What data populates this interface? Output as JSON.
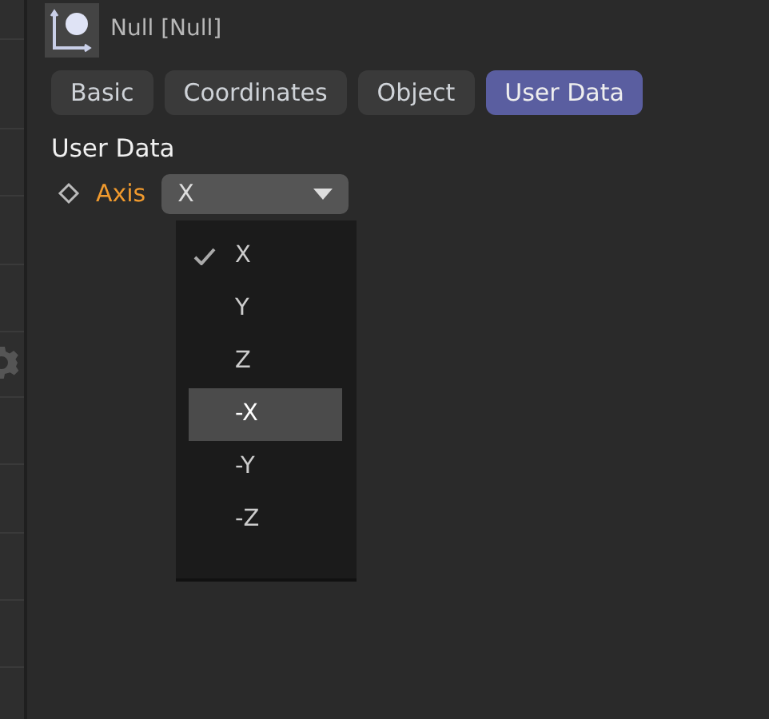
{
  "header": {
    "title": "Null [Null]"
  },
  "tabs": [
    {
      "label": "Basic",
      "selected": false
    },
    {
      "label": "Coordinates",
      "selected": false
    },
    {
      "label": "Object",
      "selected": false
    },
    {
      "label": "User Data",
      "selected": true
    }
  ],
  "section": {
    "title": "User Data"
  },
  "parameter": {
    "label": "Axis",
    "value": "X",
    "expanded": true
  },
  "menu": [
    {
      "label": "X",
      "checked": true,
      "selected": false
    },
    {
      "label": "Y",
      "checked": false,
      "selected": false
    },
    {
      "label": "Z",
      "checked": false,
      "selected": false
    },
    {
      "label": "-X",
      "checked": false,
      "selected": true
    },
    {
      "label": "-Y",
      "checked": false,
      "selected": false
    },
    {
      "label": "-Z",
      "checked": false,
      "selected": false
    }
  ]
}
